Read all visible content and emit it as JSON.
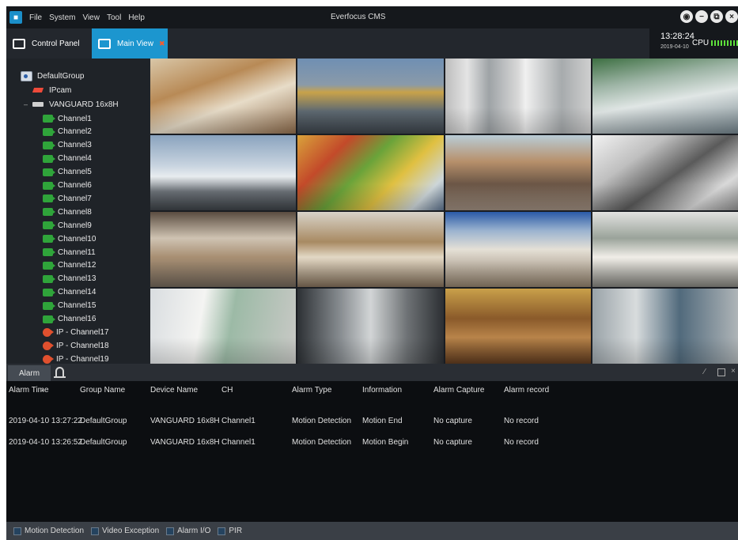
{
  "menubar": {
    "items": [
      "File",
      "System",
      "View",
      "Tool",
      "Help"
    ],
    "title": "Everfocus CMS"
  },
  "tabs": {
    "control_panel": "Control Panel",
    "main_view": "Main View"
  },
  "system_info": {
    "time": "13:28:24",
    "date": "2019-04-10",
    "cpu_label": "CPU"
  },
  "device_tree": {
    "group": "DefaultGroup",
    "ipcam": "IPcam",
    "device": "VANGUARD 16x8H",
    "channels": [
      {
        "label": "Channel1",
        "type": "dvr"
      },
      {
        "label": "Channel2",
        "type": "dvr"
      },
      {
        "label": "Channel3",
        "type": "dvr"
      },
      {
        "label": "Channel4",
        "type": "dvr"
      },
      {
        "label": "Channel5",
        "type": "dvr"
      },
      {
        "label": "Channel6",
        "type": "dvr"
      },
      {
        "label": "Channel7",
        "type": "dvr"
      },
      {
        "label": "Channel8",
        "type": "dvr"
      },
      {
        "label": "Channel9",
        "type": "dvr"
      },
      {
        "label": "Channel10",
        "type": "dvr"
      },
      {
        "label": "Channel11",
        "type": "dvr"
      },
      {
        "label": "Channel12",
        "type": "dvr"
      },
      {
        "label": "Channel13",
        "type": "dvr"
      },
      {
        "label": "Channel14",
        "type": "dvr"
      },
      {
        "label": "Channel15",
        "type": "dvr"
      },
      {
        "label": "Channel16",
        "type": "dvr"
      },
      {
        "label": "IP - Channel17",
        "type": "ip"
      },
      {
        "label": "IP - Channel18",
        "type": "ip"
      },
      {
        "label": "IP - Channel19",
        "type": "ip"
      }
    ]
  },
  "alarm_panel": {
    "tab_label": "Alarm",
    "columns": [
      "Alarm Time",
      "Group Name",
      "Device Name",
      "CH",
      "Alarm Type",
      "Information",
      "Alarm Capture",
      "Alarm record"
    ],
    "rows": [
      [
        "2019-04-10 13:27:22",
        "DefaultGroup",
        "VANGUARD 16x8H",
        "Channel1",
        "Motion Detection",
        "Motion End",
        "No capture",
        "No record"
      ],
      [
        "2019-04-10 13:26:52",
        "DefaultGroup",
        "VANGUARD 16x8H",
        "Channel1",
        "Motion Detection",
        "Motion Begin",
        "No capture",
        "No record"
      ]
    ]
  },
  "legend": [
    "Motion Detection",
    "Video Exception",
    "Alarm I/O",
    "PIR"
  ],
  "colors": {
    "accent": "#1c96cf",
    "channel_online": "#2fa43a",
    "ip_channel": "#e0502e",
    "cpu_meter": "#5ee03b"
  }
}
